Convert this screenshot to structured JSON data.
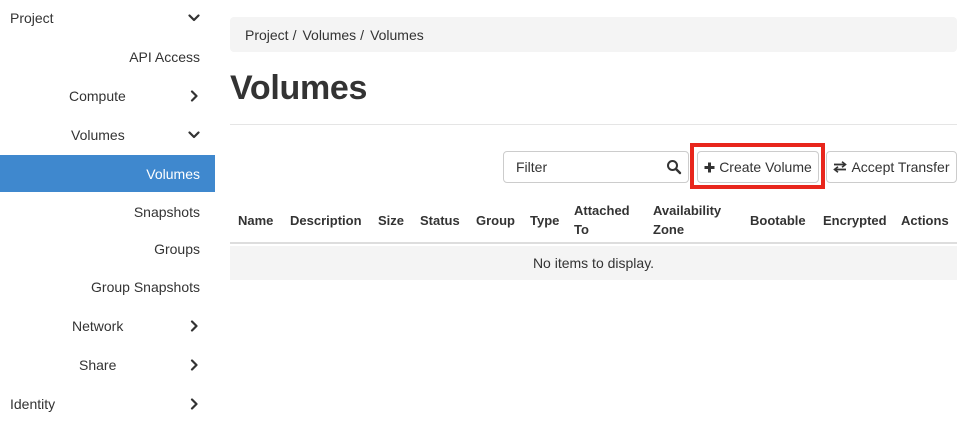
{
  "sidebar": {
    "project": "Project",
    "api_access": "API Access",
    "compute": "Compute",
    "volumes_group": "Volumes",
    "volumes": "Volumes",
    "snapshots": "Snapshots",
    "groups": "Groups",
    "group_snapshots": "Group Snapshots",
    "network": "Network",
    "share": "Share",
    "identity": "Identity"
  },
  "breadcrumb": {
    "items": [
      "Project",
      "Volumes",
      "Volumes"
    ],
    "separator": "/"
  },
  "page_title": "Volumes",
  "toolbar": {
    "filter_placeholder": "Filter",
    "create_volume_label": "Create Volume",
    "accept_transfer_label": "Accept Transfer"
  },
  "table": {
    "columns": {
      "name": "Name",
      "description": "Description",
      "size": "Size",
      "status": "Status",
      "group": "Group",
      "type": "Type",
      "attached_to_1": "Attached",
      "attached_to_2": "To",
      "availability_zone_1": "Availability",
      "availability_zone_2": "Zone",
      "bootable": "Bootable",
      "encrypted": "Encrypted",
      "actions": "Actions"
    },
    "empty_message": "No items to display."
  },
  "colors": {
    "active_bg": "#3f88ce",
    "highlight": "#e8261c",
    "panel_bg": "#f4f4f4"
  },
  "icons": {
    "expand": "chevron-down-icon",
    "collapse": "chevron-right-icon",
    "search": "search-icon",
    "plus": "plus-icon",
    "transfer": "exchange-icon"
  }
}
